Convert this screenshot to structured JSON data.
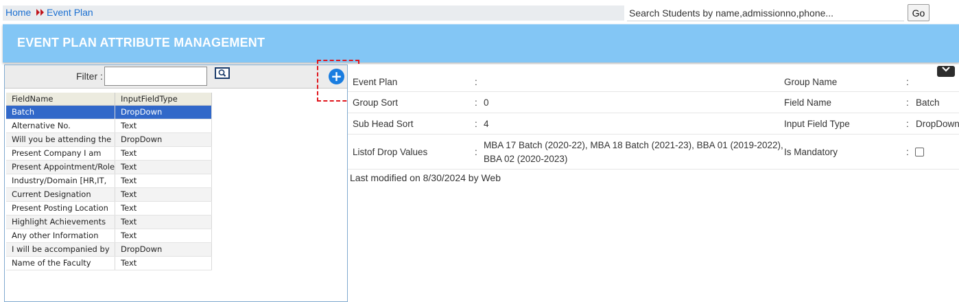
{
  "breadcrumb": {
    "home": "Home",
    "current": "Event Plan"
  },
  "search": {
    "placeholder": "Search Students by name,admissionno,phone...",
    "go_label": "Go"
  },
  "header": {
    "title": "EVENT PLAN ATTRIBUTE MANAGEMENT"
  },
  "filter": {
    "label": "Filter :",
    "value": ""
  },
  "add_button": {
    "label": "+"
  },
  "grid": {
    "columns": [
      "FieldName",
      "InputFieldType"
    ],
    "rows": [
      [
        "Batch",
        "DropDown"
      ],
      [
        "Alternative No.",
        "Text"
      ],
      [
        "Will you be attending the",
        "DropDown"
      ],
      [
        "Present Company I am",
        "Text"
      ],
      [
        "Present Appointment/Role",
        "Text"
      ],
      [
        "Industry/Domain [HR,IT,",
        "Text"
      ],
      [
        "Current Designation",
        "Text"
      ],
      [
        "Present Posting Location",
        "Text"
      ],
      [
        "Highlight Achievements",
        "Text"
      ],
      [
        "Any other Information",
        "Text"
      ],
      [
        "I will be accompanied by",
        "DropDown"
      ],
      [
        "Name of the Faculty",
        "Text"
      ]
    ],
    "selected_index": 0
  },
  "details": {
    "event_plan_label": "Event Plan",
    "event_plan_value": "",
    "group_name_label": "Group Name",
    "group_name_value": "",
    "group_sort_label": "Group Sort",
    "group_sort_value": "0",
    "field_name_label": "Field Name",
    "field_name_value": "Batch",
    "sub_head_sort_label": "Sub Head Sort",
    "sub_head_sort_value": "4",
    "input_field_type_label": "Input Field Type",
    "input_field_type_value": "DropDown",
    "drop_values_label": "Listof Drop Values",
    "drop_values_line1": "MBA 17 Batch (2020-22), MBA 18 Batch (2021-23), BBA 01 (2019-2022),",
    "drop_values_line2": "BBA 02 (2020-2023)",
    "is_mandatory_label": "Is Mandatory",
    "is_mandatory_checked": false,
    "colon": ":"
  },
  "footer": {
    "last_modified": "Last modified on 8/30/2024 by Web"
  },
  "colors": {
    "header_bg": "#83c6f5",
    "link": "#1a6fd1",
    "selected_row": "#3168c9",
    "highlight": "#e0141b"
  }
}
